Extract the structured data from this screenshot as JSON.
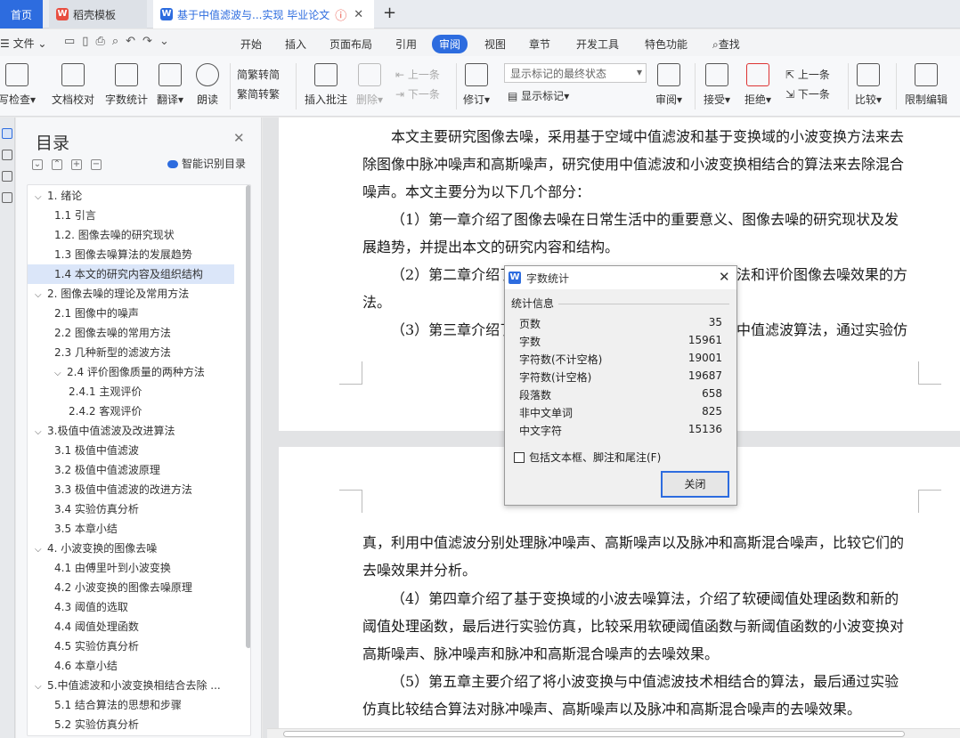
{
  "tabs": {
    "home": "首页",
    "template": "稻壳模板",
    "doc": "基于中值滤波与...实现 毕业论文"
  },
  "menu": {
    "file": "文件",
    "items": [
      "开始",
      "插入",
      "页面布局",
      "引用",
      "审阅",
      "视图",
      "章节",
      "开发工具",
      "特色功能"
    ],
    "active": "审阅",
    "search": "查找"
  },
  "ribbon": {
    "spell": "写检查",
    "proof": "文档校对",
    "wordcount": "字数统计",
    "translate": "翻译",
    "read": "朗读",
    "trad": "繁转简",
    "simp": "简转繁",
    "insert_comment": "插入批注",
    "delete": "删除",
    "prev": "上一条",
    "next": "下一条",
    "revise": "修订",
    "show_markup": "显示标记",
    "markup_select": "显示标记的最终状态",
    "review": "审阅",
    "accept": "接受",
    "reject": "拒绝",
    "prev2": "上一条",
    "next2": "下一条",
    "compare": "比较",
    "restrict": "限制编辑"
  },
  "toc": {
    "title": "目录",
    "smart": "智能识别目录",
    "items": [
      "1. 绪论",
      "1.1 引言",
      "1.2. 图像去噪的研究现状",
      "1.3 图像去噪算法的发展趋势",
      "1.4 本文的研究内容及组织结构",
      "2. 图像去噪的理论及常用方法",
      "2.1 图像中的噪声",
      "2.2 图像去噪的常用方法",
      "2.3 几种新型的滤波方法",
      "2.4 评价图像质量的两种方法",
      "2.4.1 主观评价",
      "2.4.2 客观评价",
      "3.极值中值滤波及改进算法",
      "3.1 极值中值滤波",
      "3.2 极值中值滤波原理",
      "3.3 极值中值滤波的改进方法",
      "3.4 实验仿真分析",
      "3.5 本章小结",
      "4. 小波变换的图像去噪",
      "4.1 由傅里叶到小波变换",
      "4.2 小波变换的图像去噪原理",
      "4.3 阈值的选取",
      "4.4 阈值处理函数",
      "4.5 实验仿真分析",
      "4.6 本章小结",
      "5.中值滤波和小波变换相结合去除 ...",
      "5.1 结合算法的思想和步骤",
      "5.2 实验仿真分析"
    ]
  },
  "doc": {
    "p1": "本文主要研究图像去噪，采用基于空域中值滤波和基于变换域的小波变换方法来去除图像中脉冲噪声和高斯噪声，研究使用中值滤波和小波变换相结合的算法来去除混合噪声。本文主要分为以下几个部分：",
    "p2": "（1）第一章介绍了图像去噪在日常生活中的重要意义、图像去噪的研究现状及发展趋势，并提出本文的研究内容和结构。",
    "p3a": "（2）第二章介绍了",
    "p3b": "法和评价图像去噪效果的方",
    "p3c": "法。",
    "p4a": "（3）第三章介绍了",
    "p4b": "中值滤波算法，通过实验仿",
    "p5": "真，利用中值滤波分别处理脉冲噪声、高斯噪声以及脉冲和高斯混合噪声，比较它们的去噪效果并分析。",
    "p6": "（4）第四章介绍了基于变换域的小波去噪算法，介绍了软硬阈值处理函数和新的阈值处理函数，最后进行实验仿真，比较采用软硬阈值函数与新阈值函数的小波变换对高斯噪声、脉冲噪声和脉冲和高斯混合噪声的去噪效果。",
    "p7": "（5）第五章主要介绍了将小波变换与中值滤波技术相结合的算法，最后通过实验仿真比较结合算法对脉冲噪声、高斯噪声以及脉冲和高斯混合噪声的去噪效果。"
  },
  "dialog": {
    "title": "字数统计",
    "section": "统计信息",
    "stats": [
      {
        "k": "页数",
        "v": "35"
      },
      {
        "k": "字数",
        "v": "15961"
      },
      {
        "k": "字符数(不计空格)",
        "v": "19001"
      },
      {
        "k": "字符数(计空格)",
        "v": "19687"
      },
      {
        "k": "段落数",
        "v": "658"
      },
      {
        "k": "非中文单词",
        "v": "825"
      },
      {
        "k": "中文字符",
        "v": "15136"
      }
    ],
    "checkbox": "包括文本框、脚注和尾注(F)",
    "close": "关闭"
  },
  "colors": {
    "accent": "#2d6cdf"
  }
}
